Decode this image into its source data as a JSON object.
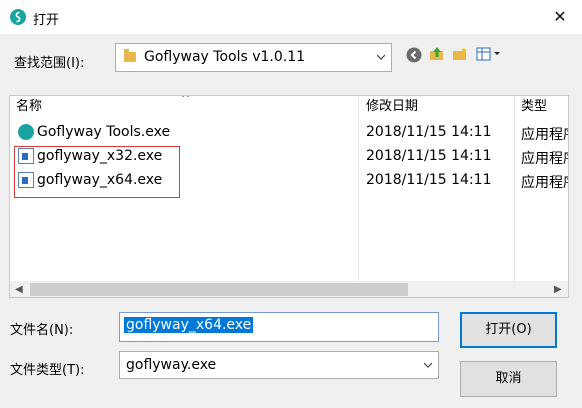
{
  "window": {
    "title": "打开",
    "close_glyph": "✕"
  },
  "lookin": {
    "label": "查找范围(I):",
    "value": "Goflyway Tools v1.0.11"
  },
  "toolbar": {
    "back_icon": "back-arrow-icon",
    "up_icon": "up-folder-icon",
    "newfolder_icon": "new-folder-icon",
    "view_icon": "view-menu-icon"
  },
  "list": {
    "columns": [
      "名称",
      "修改日期",
      "类型"
    ],
    "rows": [
      {
        "name": "Goflyway Tools.exe",
        "date": "2018/11/15 14:11",
        "type": "应用程序"
      },
      {
        "name": "goflyway_x32.exe",
        "date": "2018/11/15 14:11",
        "type": "应用程序"
      },
      {
        "name": "goflyway_x64.exe",
        "date": "2018/11/15 14:11",
        "type": "应用程序"
      }
    ]
  },
  "filename": {
    "label": "文件名(N):",
    "value": "goflyway_x64.exe"
  },
  "filetype": {
    "label": "文件类型(T):",
    "value": "goflyway.exe"
  },
  "buttons": {
    "open": "打开(O)",
    "cancel": "取消"
  }
}
